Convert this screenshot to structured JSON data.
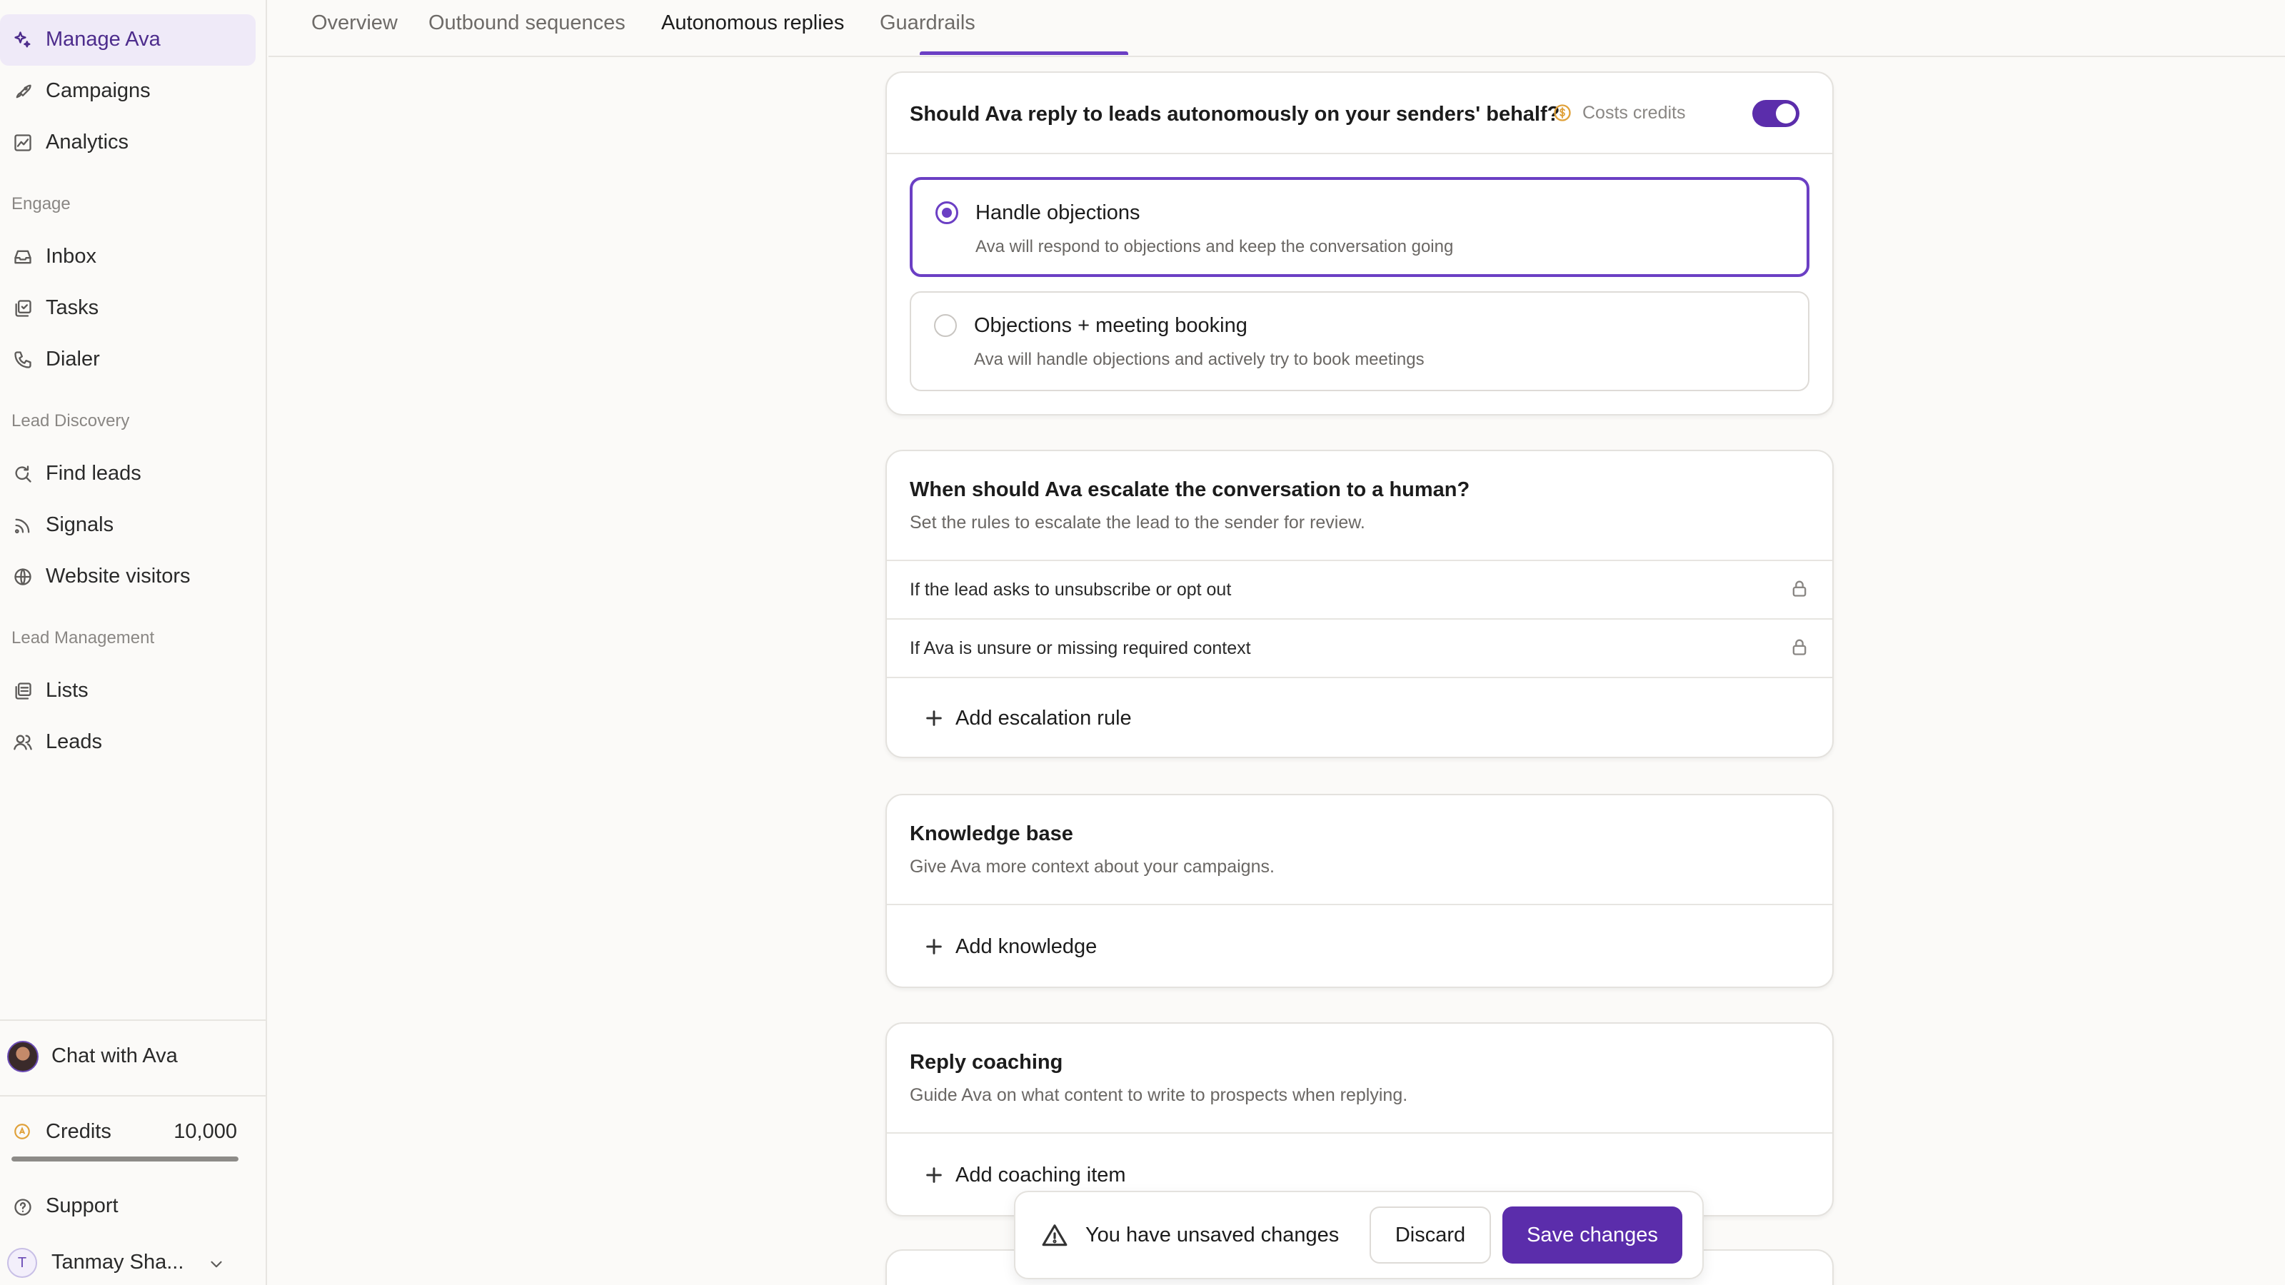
{
  "sidebar": {
    "primary": [
      {
        "label": "Manage Ava",
        "icon": "sparkle-icon",
        "active": true
      },
      {
        "label": "Campaigns",
        "icon": "rocket-icon"
      },
      {
        "label": "Analytics",
        "icon": "chart-line-icon"
      }
    ],
    "engage": {
      "label": "Engage",
      "items": [
        {
          "label": "Inbox",
          "icon": "inbox-icon"
        },
        {
          "label": "Tasks",
          "icon": "tasks-icon"
        },
        {
          "label": "Dialer",
          "icon": "phone-icon"
        }
      ]
    },
    "lead_discovery": {
      "label": "Lead Discovery",
      "items": [
        {
          "label": "Find leads",
          "icon": "search-refresh-icon"
        },
        {
          "label": "Signals",
          "icon": "signal-icon"
        },
        {
          "label": "Website visitors",
          "icon": "globe-icon"
        }
      ]
    },
    "lead_management": {
      "label": "Lead Management",
      "items": [
        {
          "label": "Lists",
          "icon": "list-icon"
        },
        {
          "label": "Leads",
          "icon": "users-icon"
        }
      ]
    },
    "chat_label": "Chat with Ava",
    "credits_label": "Credits",
    "credits_value": "10,000",
    "credits_fraction": 1.0,
    "support_label": "Support",
    "user_initial": "T",
    "user_name": "Tanmay Sha..."
  },
  "tabs": [
    {
      "label": "Overview"
    },
    {
      "label": "Outbound sequences"
    },
    {
      "label": "Autonomous replies",
      "active": true
    },
    {
      "label": "Guardrails"
    }
  ],
  "reply_card": {
    "title": "Should Ava reply to leads autonomously on your senders' behalf?",
    "credits_hint": "Costs credits",
    "enabled": true,
    "options": [
      {
        "title": "Handle objections",
        "desc": "Ava will respond to objections and keep the conversation going",
        "selected": true
      },
      {
        "title": "Objections + meeting booking",
        "desc": "Ava will handle objections and actively try to book meetings",
        "selected": false
      }
    ]
  },
  "escalation_card": {
    "title": "When should Ava escalate the conversation to a human?",
    "subtitle": "Set the rules to escalate the lead to the sender for review.",
    "rules": [
      "If the lead asks to unsubscribe or opt out",
      "If Ava is unsure or missing required context"
    ],
    "add_label": "Add escalation rule"
  },
  "knowledge_card": {
    "title": "Knowledge base",
    "subtitle": "Give Ava more context about your campaigns.",
    "add_label": "Add knowledge"
  },
  "coaching_card": {
    "title": "Reply coaching",
    "subtitle": "Guide Ava on what content to write to prospects when replying.",
    "add_label": "Add coaching item"
  },
  "unsaved_bar": {
    "message": "You have unsaved changes",
    "discard_label": "Discard",
    "save_label": "Save changes"
  },
  "colors": {
    "accent": "#5b2dab",
    "accent_light": "#efeaf8",
    "credits_coin": "#e0a13a"
  }
}
